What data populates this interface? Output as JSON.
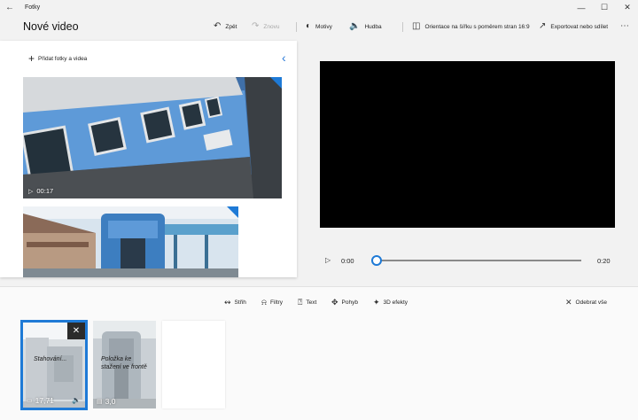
{
  "app": {
    "title": "Fotky"
  },
  "header": {
    "page_title": "Nové video",
    "undo_label": "Zpět",
    "redo_label": "Znovu",
    "themes_label": "Motivy",
    "music_label": "Hudba",
    "aspect_label": "Orientace na šířku s poměrem stran 16:9",
    "export_label": "Exportovat nebo sdílet"
  },
  "library": {
    "add_label": "Přidat fotky a videa",
    "items": [
      {
        "duration": "00:17",
        "type": "video"
      },
      {
        "duration": "",
        "type": "video"
      }
    ]
  },
  "player": {
    "current_time": "0:00",
    "total_time": "0:20",
    "progress": 0
  },
  "storyboard": {
    "tools": {
      "trim": "Střih",
      "filters": "Filtry",
      "text": "Text",
      "motion": "Pohyb",
      "effects3d": "3D efekty",
      "remove_all": "Odebrat vše"
    },
    "cards": [
      {
        "label": "Stahování...",
        "duration": "17,71",
        "selected": true
      },
      {
        "label": "Položka ke stažení ve frontě",
        "duration": "3,0",
        "selected": false
      },
      {
        "label": "",
        "duration": "",
        "selected": false
      }
    ]
  },
  "colors": {
    "accent": "#1e7ad6",
    "preview_bg": "#000000"
  },
  "icons": [
    "back-arrow-icon",
    "minimize-icon",
    "maximize-icon",
    "close-icon",
    "undo-icon",
    "redo-icon",
    "themes-icon",
    "speaker-icon",
    "aspect-icon",
    "share-icon",
    "more-icon",
    "plus-icon",
    "chevron-left-icon",
    "play-icon",
    "trim-icon",
    "filter-icon",
    "text-icon",
    "motion-icon",
    "effects-icon",
    "close-x-icon",
    "video-icon",
    "image-icon"
  ]
}
